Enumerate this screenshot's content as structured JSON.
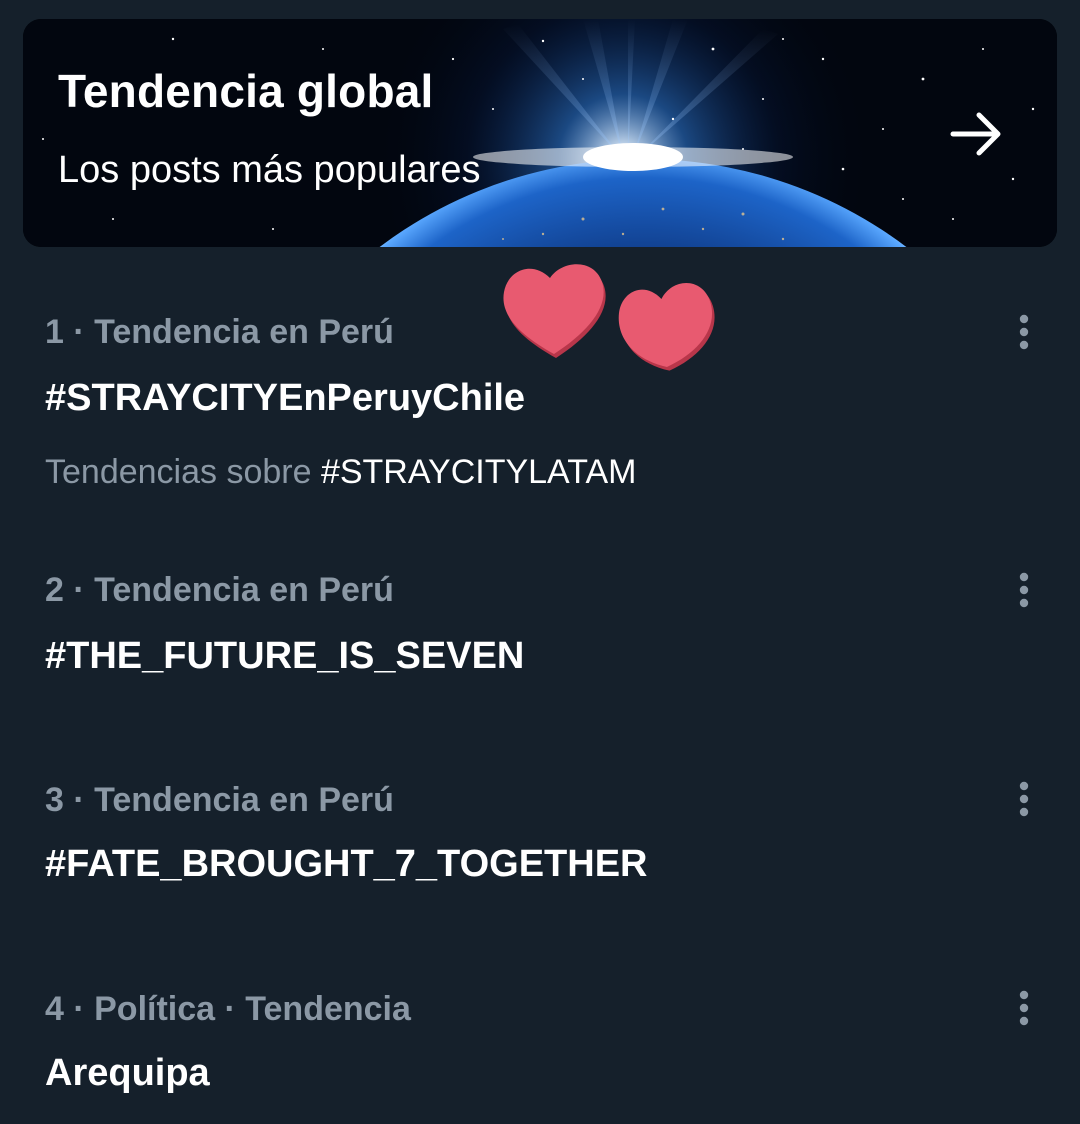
{
  "banner": {
    "title": "Tendencia global",
    "subtitle": "Los posts más populares",
    "arrow_icon": "arrow-right-icon"
  },
  "sticker": {
    "icon": "hearts-sticker-icon",
    "color": "#e85a70"
  },
  "trends": [
    {
      "meta": "1 · Tendencia en Perú",
      "name": "#STRAYCITYEnPeruyChile",
      "related_prefix": "Tendencias sobre ",
      "related_tag": "#STRAYCITYLATAM"
    },
    {
      "meta": "2 · Tendencia en Perú",
      "name": "#THE_FUTURE_IS_SEVEN"
    },
    {
      "meta": "3 · Tendencia en Perú",
      "name": "#FATE_BROUGHT_7_TOGETHER"
    },
    {
      "meta": "4 · Política · Tendencia",
      "name": "Arequipa"
    }
  ],
  "colors": {
    "background": "#15202b",
    "secondary_text": "#8b98a5",
    "primary_text": "#ffffff"
  }
}
